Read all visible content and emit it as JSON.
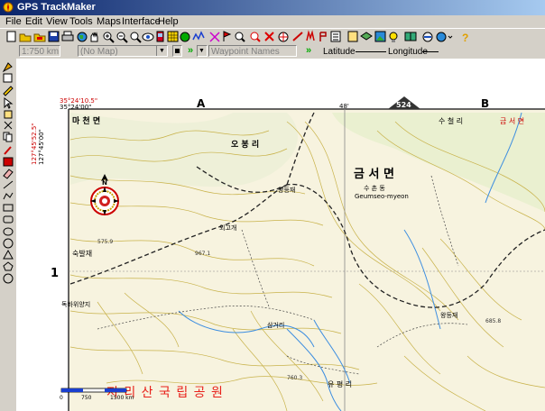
{
  "window": {
    "title": "GPS TrackMaker"
  },
  "menu": [
    "File",
    "Edit",
    "View",
    "Tools",
    "Maps",
    "Interface",
    "Help"
  ],
  "toolbar2": {
    "scale_value": "1:750 km",
    "map_value": "(No Map)",
    "waypoint_placeholder": "Waypoint Names",
    "latitude_label": "Latitude",
    "longitude_label": "Longitude"
  },
  "map": {
    "coord_top_1": "35°24'10.5\"",
    "coord_top_2": "35°24'00\"",
    "coord_left_1": "127°45'52.5\"",
    "coord_left_2": "127°45'00\"",
    "grid_col_a": "A",
    "grid_col_b": "B",
    "grid_row_1": "1",
    "minute_mark": "48'",
    "elevation_badge": "524",
    "place_labels": [
      "마 천 면",
      "오 봉 리",
      "금 서 면",
      "수 철 리",
      "금 서 면",
      "수 촌 동",
      "Geumseo-myeon",
      "왕등재",
      "외고개",
      "숙발재",
      "독바위양지",
      "왕등재",
      "삼거리",
      "유 평 리",
      "지 리 산 국 립 공 원"
    ],
    "scale_bar": [
      "0",
      "750",
      "1500 km"
    ],
    "colors": {
      "park_label": "#e8201a",
      "contour": "#c8b24a",
      "water": "#3d8ee0",
      "map_bg": "#f7f3df"
    }
  }
}
